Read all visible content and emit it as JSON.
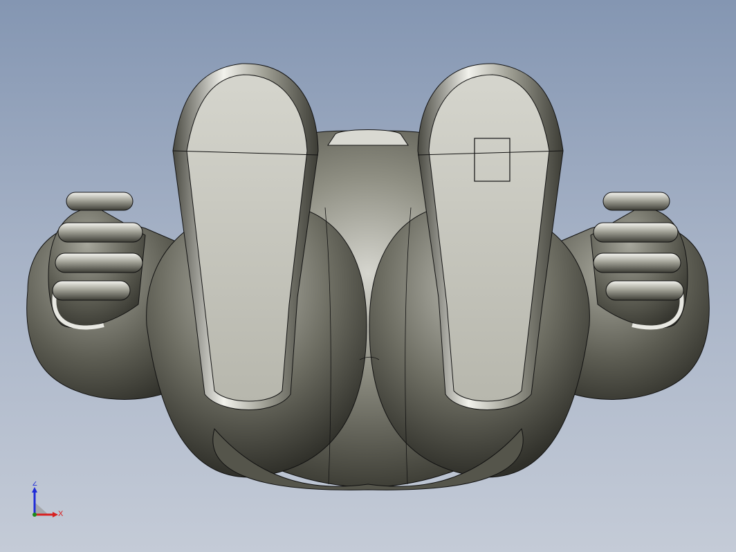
{
  "viewport": {
    "background_top": "#8496b2",
    "background_bottom": "#c4cbd7",
    "model_color": "#8c8c7e",
    "edge_color": "#111111",
    "sole_color": "#c9c9bf"
  },
  "triad": {
    "z_label": "Z",
    "x_label": "X",
    "z_color": "#1f2bd8",
    "x_color": "#d81f1f",
    "origin_color": "#1a8a1a"
  }
}
